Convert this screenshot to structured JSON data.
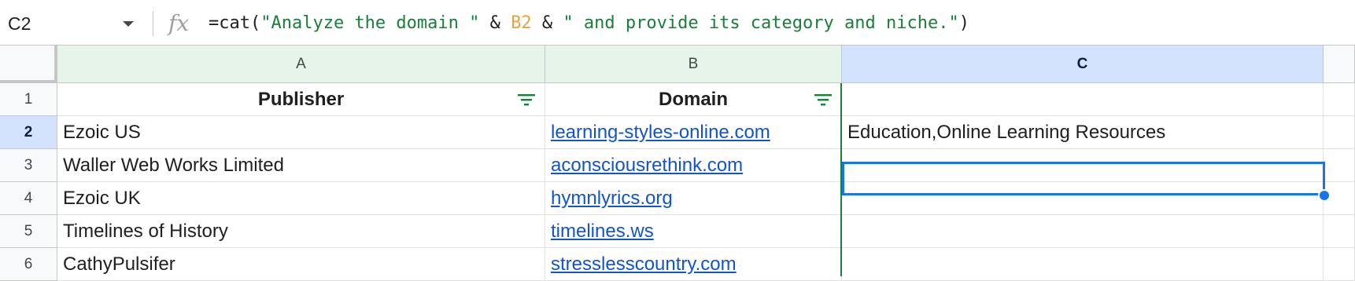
{
  "formula_bar": {
    "name_box": "C2",
    "fx_icon": "fx-icon",
    "formula_tokens": [
      {
        "text": "=cat(",
        "kind": "op"
      },
      {
        "text": "\"Analyze the domain \"",
        "kind": "str"
      },
      {
        "text": " & ",
        "kind": "op"
      },
      {
        "text": "B2",
        "kind": "ref"
      },
      {
        "text": " & ",
        "kind": "op"
      },
      {
        "text": "\" and provide its category and niche.\"",
        "kind": "str"
      },
      {
        "text": ")",
        "kind": "op"
      }
    ]
  },
  "columns": [
    {
      "letter": "A",
      "state": "filtered"
    },
    {
      "letter": "B",
      "state": "filtered"
    },
    {
      "letter": "C",
      "state": "selected"
    }
  ],
  "rows": [
    {
      "num": "1",
      "A": "Publisher",
      "B": "Domain",
      "C": ""
    },
    {
      "num": "2",
      "A": "Ezoic US",
      "B": "learning-styles-online.com",
      "C": "Education,Online Learning Resources"
    },
    {
      "num": "3",
      "A": "Waller Web Works Limited",
      "B": "aconsciousrethink.com",
      "C": ""
    },
    {
      "num": "4",
      "A": "Ezoic UK",
      "B": "hymnlyrics.org",
      "C": ""
    },
    {
      "num": "5",
      "A": "Timelines of History",
      "B": "timelines.ws",
      "C": ""
    },
    {
      "num": "6",
      "A": "CathyPulsifer",
      "B": "stresslesscountry.com",
      "C": ""
    }
  ],
  "active_cell": "C2",
  "colors": {
    "selection": "#1a73e8",
    "string_token": "#188038",
    "reference_token": "#e8a33d",
    "link": "#1155cc",
    "filter_icon": "#188038"
  }
}
